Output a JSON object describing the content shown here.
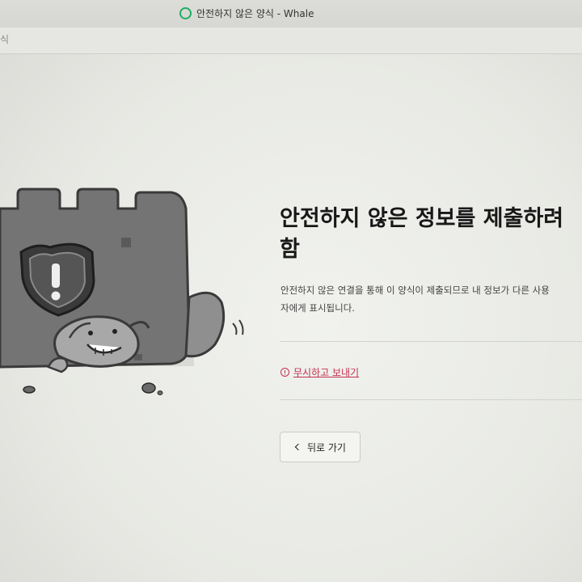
{
  "window": {
    "title": "안전하지 않은 양식 - Whale",
    "edge_glyph": "식",
    "app_icon": "whale-browser-icon"
  },
  "warning": {
    "heading": "안전하지 않은 정보를 제출하려 함",
    "description": "안전하지 않은 연결을 통해 이 양식이 제출되므로 내 정보가 다른 사용자에게 표시됩니다.",
    "ignore_link": "무시하고 보내기",
    "back_button": "뒤로 가기"
  },
  "colors": {
    "accent_warning": "#c5304f",
    "whale_green": "#1fae60",
    "illustration_body": "#6f6f6f",
    "page_background": "#ecedea"
  },
  "icons": {
    "warning": "exclamation-circle-icon",
    "back": "chevron-left-icon",
    "illustration": "shield-wall-with-mascot"
  }
}
